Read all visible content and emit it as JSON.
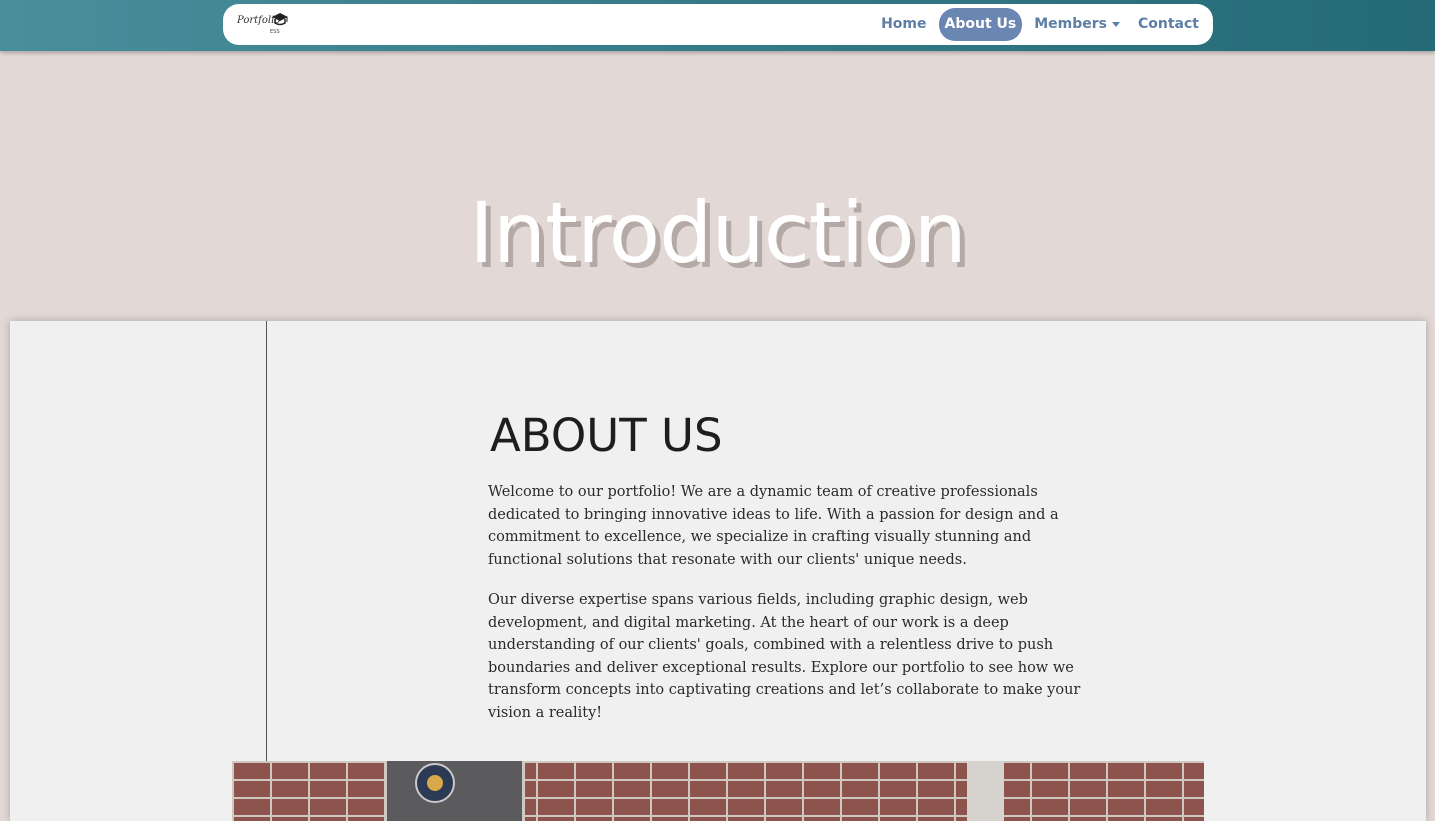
{
  "navbar": {
    "logo": {
      "script_text": "Portfolio",
      "sub_text": "ESS"
    },
    "items": [
      {
        "label": "Home",
        "active": false
      },
      {
        "label": "About Us",
        "active": true
      },
      {
        "label": "Members",
        "active": false,
        "dropdown": true
      },
      {
        "label": "Contact",
        "active": false
      }
    ]
  },
  "hero": {
    "title": "Introduction"
  },
  "about": {
    "heading": "ABOUT US",
    "paragraphs": [
      "Welcome to our portfolio! We are a dynamic team of creative professionals dedicated to bringing innovative ideas to life. With a passion for design and a commitment to excellence, we specialize in crafting visually stunning and functional solutions that resonate with our clients' unique needs.",
      "Our diverse expertise spans various fields, including graphic design, web development, and digital marketing. At the heart of our work is a deep understanding of our clients' goals, combined with a relentless drive to push boundaries and deliver exceptional results. Explore our portfolio to see how we transform concepts into captivating creations and let’s collaborate to make your vision a reality!"
    ]
  },
  "colors": {
    "topbar": "#357a88",
    "active_nav": "#6a86b3",
    "nav_text": "#5d7fa5",
    "page_bg": "#e2d9d6",
    "card_bg": "#f0f0f0"
  }
}
